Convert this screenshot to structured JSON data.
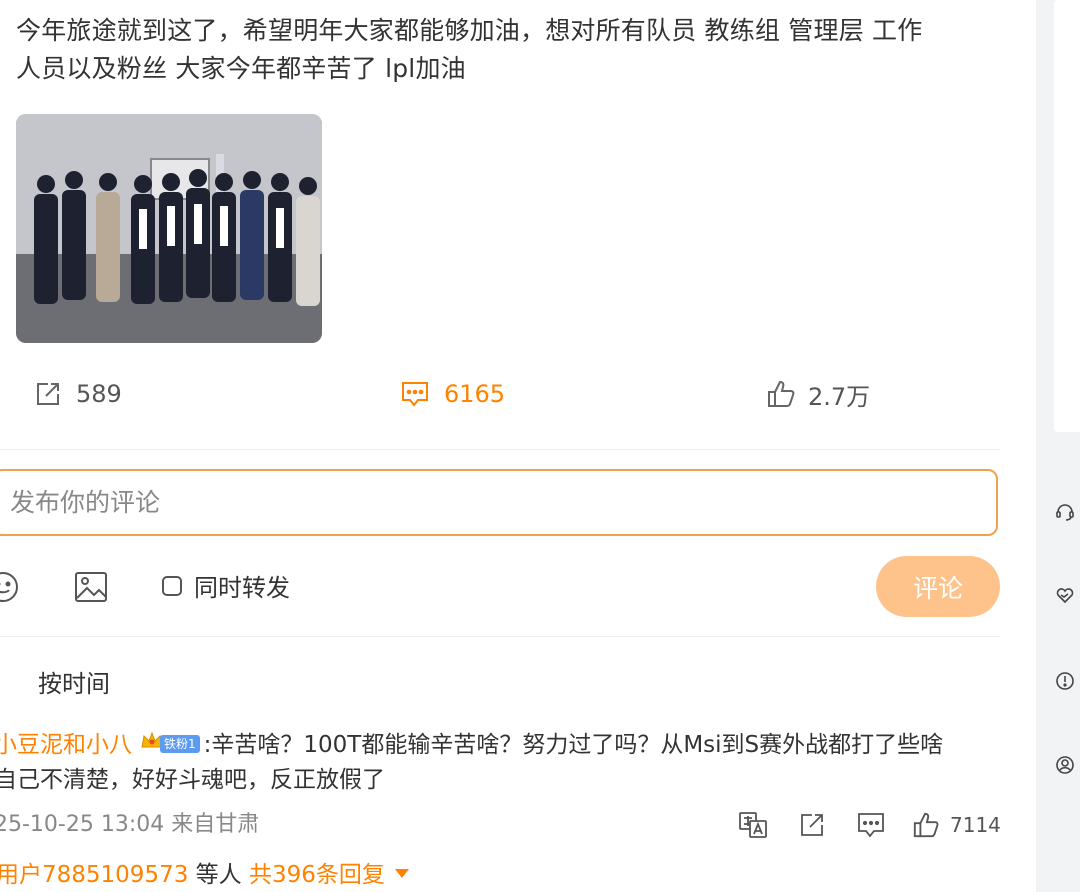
{
  "post": {
    "text_line1": "今年旅途就到这了，希望明年大家都能够加油，想对所有队员 教练组 管理层 工作",
    "text_line2": "人员以及粉丝 大家今年都辛苦了  lpl加油",
    "image_icon": "team-photo"
  },
  "actions": {
    "repost_count": "589",
    "comment_count": "6165",
    "like_count": "2.7万",
    "active_color": "#ff8200"
  },
  "composer": {
    "placeholder": "发布你的评论",
    "repost_checkbox_label": "同时转发",
    "submit_label": "评论",
    "accent_color": "#f0a14a"
  },
  "sort": {
    "label": "按时间"
  },
  "comment": {
    "username": "小豆泥和小八",
    "fan_badge": "铁粉1",
    "text_line1": ":辛苦啥？100T都能输辛苦啥？努力过了吗？从Msi到S赛外战都打了些啥",
    "text_line2": "自己不清楚，好好斗魂吧，反正放假了",
    "meta": "25-10-25 13:04 来自甘肃",
    "like_count": "7114",
    "reply_users": "用户7885109573",
    "reply_mid": " 等人 ",
    "reply_total": "共396条回复"
  },
  "icons": {
    "repost": "repost-icon",
    "comment": "comment-icon",
    "like": "thumbs-up-icon",
    "emoji": "emoji-icon",
    "image": "image-icon",
    "translate": "translate-icon",
    "side": [
      "headset-icon",
      "heart-hands-icon",
      "alert-circle-icon",
      "user-circle-icon"
    ]
  }
}
